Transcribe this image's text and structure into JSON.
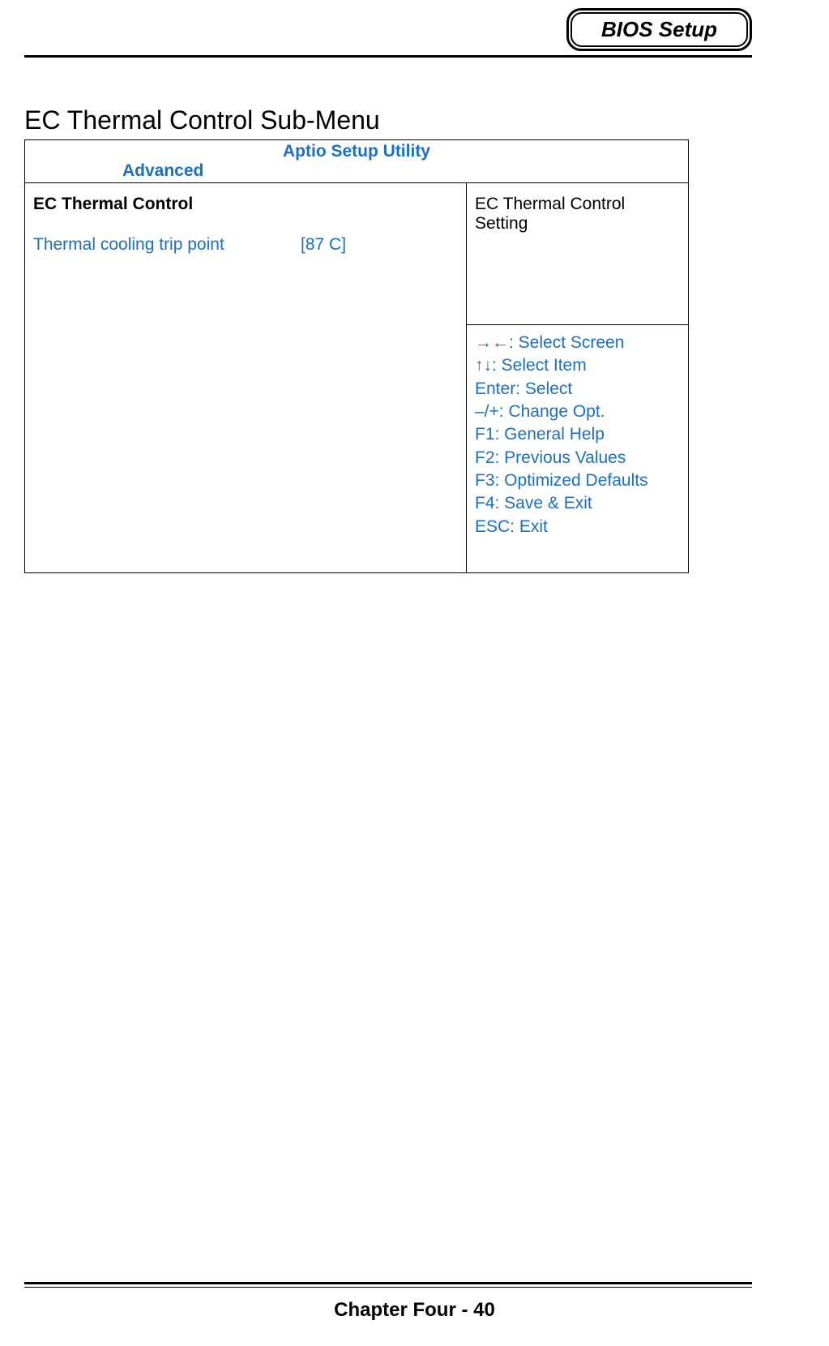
{
  "header": {
    "badge": "BIOS Setup"
  },
  "section_title": "EC Thermal Control Sub-Menu",
  "bios": {
    "utility_title": "Aptio Setup Utility",
    "tab": "Advanced",
    "left": {
      "heading": "EC Thermal Control",
      "option": {
        "label": "Thermal cooling trip point",
        "value": "[87 C]"
      }
    },
    "right": {
      "help": "EC Thermal Control Setting",
      "keys": [
        "→←: Select Screen",
        "↑↓: Select Item",
        "Enter: Select",
        "–/+: Change Opt.",
        "F1: General Help",
        "F2: Previous Values",
        "F3: Optimized Defaults",
        "F4: Save & Exit",
        "ESC: Exit"
      ]
    }
  },
  "footer": "Chapter Four - 40"
}
